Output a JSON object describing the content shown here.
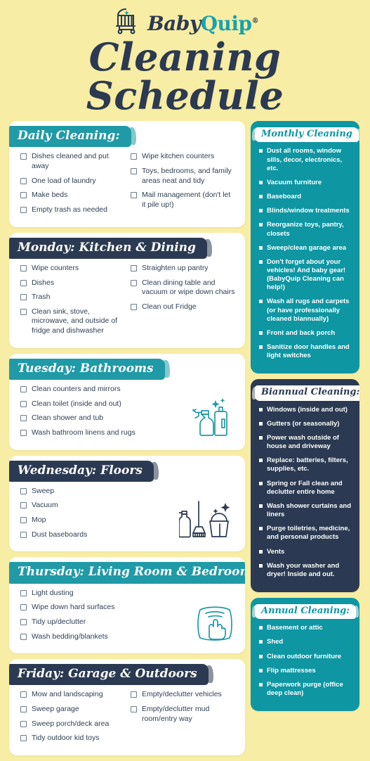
{
  "brand": {
    "logo_icon": "baby-stroller-icon",
    "name_part1": "Baby",
    "name_part2": "Quip",
    "registered_mark": "®"
  },
  "header": {
    "title": "Cleaning Schedule"
  },
  "colors": {
    "background": "#f8eda4",
    "teal": "#1f9aa6",
    "panel_teal": "#0e96a3",
    "navy": "#2b3a52",
    "card": "#ffffff",
    "text": "#2f3e54"
  },
  "left_column": [
    {
      "id": "daily",
      "title": "Daily Cleaning:",
      "banner_style": "teal",
      "art": null,
      "columns": [
        [
          "Dishes cleaned and put away",
          "One load of laundry",
          "Make beds",
          "Empty trash as needed"
        ],
        [
          "Wipe kitchen counters",
          "Toys, bedrooms, and family areas neat and tidy",
          "Mail management (don't let it pile up!)"
        ]
      ]
    },
    {
      "id": "monday",
      "title": "Monday:  Kitchen & Dining",
      "banner_style": "navy",
      "art": null,
      "columns": [
        [
          "Wipe counters",
          "Dishes",
          "Trash",
          "Clean sink, stove, microwave, and outside of fridge and dishwasher"
        ],
        [
          "Straighten up pantry",
          "Clean dining table and vacuum or wipe down chairs",
          "Clean out Fridge"
        ]
      ]
    },
    {
      "id": "tuesday",
      "title": "Tuesday:  Bathrooms",
      "banner_style": "teal",
      "art": "spray-bottle-and-cleaner-icon",
      "columns": [
        [
          "Clean counters and mirrors",
          "Clean toilet (inside and out)",
          "Clean shower and tub",
          "Wash bathroom linens and rugs"
        ]
      ]
    },
    {
      "id": "wednesday",
      "title": "Wednesday:  Floors",
      "banner_style": "navy",
      "art": "broom-and-bucket-icon",
      "columns": [
        [
          "Sweep",
          "Vacuum",
          "Mop",
          "Dust baseboards"
        ]
      ]
    },
    {
      "id": "thursday",
      "title": "Thursday:  Living Room & Bedrooms",
      "banner_style": "teal",
      "art": "hand-wiping-cloth-icon",
      "columns": [
        [
          "Light dusting",
          "Wipe down hard surfaces",
          "Tidy up/declutter",
          "Wash bedding/blankets"
        ]
      ]
    },
    {
      "id": "friday",
      "title": "Friday:  Garage & Outdoors",
      "banner_style": "navy",
      "art": null,
      "columns": [
        [
          "Mow and landscaping",
          "Sweep garage",
          "Sweep porch/deck area",
          "Tidy outdoor kid toys"
        ],
        [
          "Empty/declutter vehicles",
          "Empty/declutter mud room/entry way"
        ]
      ]
    }
  ],
  "right_column": [
    {
      "id": "monthly",
      "title": "Monthly Cleaning",
      "panel_style": "teal",
      "items": [
        "Dust all rooms, window sills, decor, electronics, etc.",
        "Vacuum furniture",
        "Baseboard",
        "Blinds/window treatments",
        "Reorganize toys, pantry, closets",
        "Sweep/clean garage area",
        "Don't forget about your vehicles! And baby gear! (BabyQuip Cleaning can help!)",
        "Wash all rugs and carpets (or have professionally cleaned biannually)",
        "Front and back porch",
        "Sanitize door handles and light switches"
      ]
    },
    {
      "id": "biannual",
      "title": "Biannual Cleaning:",
      "panel_style": "navy",
      "items": [
        "Windows (inside and out)",
        "Gutters (or seasonally)",
        "Power wash outside of house and driveway",
        "Replace: batteries, filters, supplies, etc.",
        "Spring or Fall clean and declutter entire home",
        "Wash shower curtains and liners",
        "Purge toiletries, medicine, and personal products",
        "Vents",
        "Wash your washer and dryer! Inside and out."
      ]
    },
    {
      "id": "annual",
      "title": "Annual Cleaning:",
      "panel_style": "teal",
      "items": [
        "Basement or attic",
        "Shed",
        "Clean outdoor furniture",
        "Flip mattresses",
        "Paperwork purge (office deep clean)"
      ]
    }
  ]
}
